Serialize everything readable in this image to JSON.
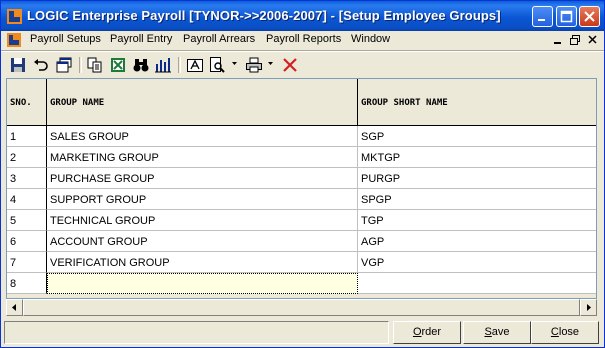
{
  "window": {
    "title": "LOGIC Enterprise Payroll  [TYNOR->>2006-2007] - [Setup Employee Groups]"
  },
  "menu": {
    "items": [
      "Payroll Setups",
      "Payroll Entry",
      "Payroll Arrears",
      "Payroll Reports",
      "Window"
    ]
  },
  "toolbar": {
    "icons": [
      "save-icon",
      "undo-icon",
      "window-icon",
      "copy-icon",
      "excel-icon",
      "binoculars-icon",
      "chart-icon",
      "font-icon",
      "print-preview-icon",
      "printer-icon",
      "delete-icon"
    ]
  },
  "grid": {
    "headers": [
      "SNO.",
      "GROUP NAME",
      "GROUP SHORT NAME"
    ],
    "rows": [
      {
        "sno": "1",
        "name": "SALES GROUP",
        "short": "SGP"
      },
      {
        "sno": "2",
        "name": "MARKETING GROUP",
        "short": "MKTGP"
      },
      {
        "sno": "3",
        "name": "PURCHASE GROUP",
        "short": "PURGP"
      },
      {
        "sno": "4",
        "name": "SUPPORT GROUP",
        "short": "SPGP"
      },
      {
        "sno": "5",
        "name": "TECHNICAL GROUP",
        "short": "TGP"
      },
      {
        "sno": "6",
        "name": "ACCOUNT GROUP",
        "short": "AGP"
      },
      {
        "sno": "7",
        "name": "VERIFICATION GROUP",
        "short": "VGP"
      },
      {
        "sno": "8",
        "name": "",
        "short": ""
      }
    ]
  },
  "buttons": {
    "order": {
      "accel": "O",
      "rest": "rder"
    },
    "save": {
      "accel": "S",
      "rest": "ave"
    },
    "close": {
      "accel": "C",
      "rest": "lose"
    }
  },
  "colors": {
    "titlebar": "#0a5fd7",
    "active_cell": "#ffffe1",
    "face": "#ece9d8"
  }
}
